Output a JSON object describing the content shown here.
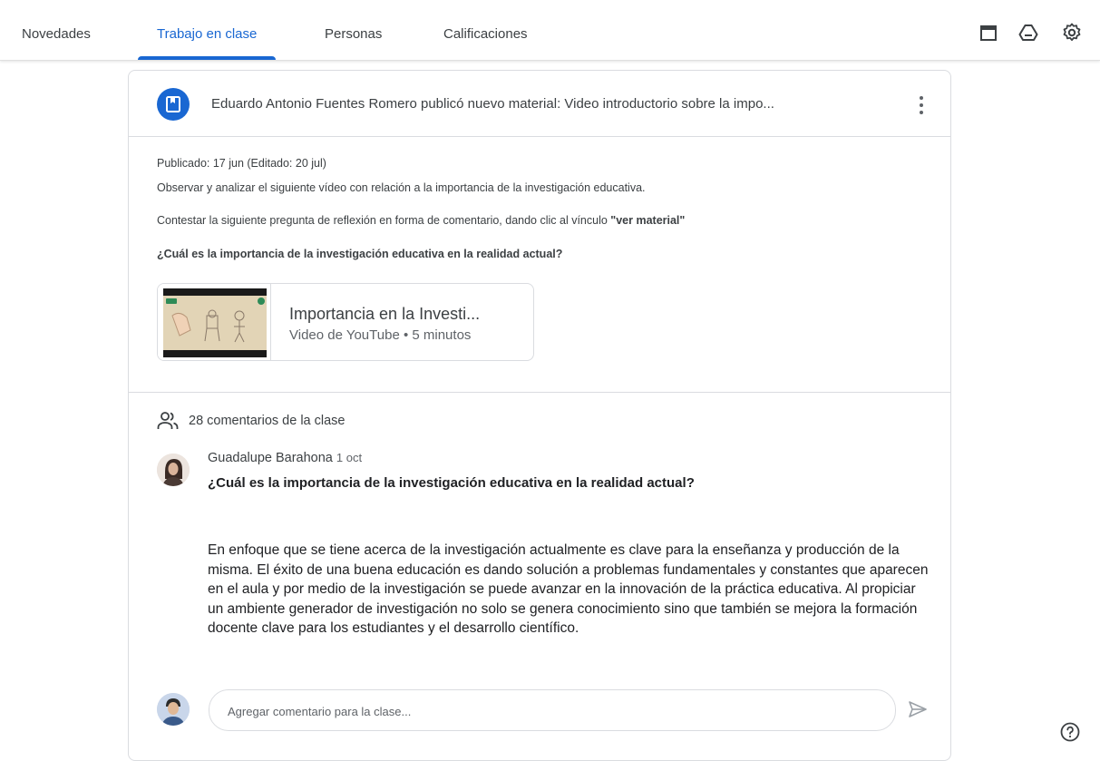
{
  "nav": {
    "tabs": [
      {
        "label": "Novedades",
        "active": false
      },
      {
        "label": "Trabajo en clase",
        "active": true
      },
      {
        "label": "Personas",
        "active": false
      },
      {
        "label": "Calificaciones",
        "active": false
      }
    ],
    "icons": [
      "calendar-icon",
      "google-drive-icon",
      "settings-icon"
    ]
  },
  "post": {
    "header": "Eduardo Antonio Fuentes Romero publicó nuevo material: Video introductorio sobre la impo...",
    "posted": "Publicado: 17 jun (Editado: 20 jul)",
    "description_1": "Observar y analizar el siguiente vídeo con relación a la importancia de la investigación educativa.",
    "description_2_prefix": "Contestar la siguiente pregunta de reflexión en forma de comentario, dando clic al vínculo ",
    "description_2_link": "\"ver material\"",
    "question": "¿Cuál es la importancia de la investigación educativa en la realidad actual?",
    "attachment": {
      "title": "Importancia en la Investi...",
      "subtitle": "Video de YouTube • 5 minutos"
    }
  },
  "comments": {
    "count_label": "28 comentarios de la clase",
    "items": [
      {
        "author": "Guadalupe Barahona",
        "date": "1 oct",
        "question": "¿Cuál es la importancia de la investigación educativa en la realidad actual?",
        "body": "En enfoque que se tiene acerca de la investigación actualmente es clave para la enseñanza y producción de la misma. El éxito de una buena educación es dando solución a problemas fundamentales y constantes que aparecen en el aula y por medio de la investigación se puede avanzar en la innovación de la práctica educativa. Al propiciar un ambiente generador de investigación no solo se genera conocimiento sino que también se mejora la formación docente clave para los estudiantes y el desarrollo científico."
      }
    ],
    "input_placeholder": "Agregar comentario para la clase..."
  },
  "colors": {
    "accent": "#1967d2",
    "text": "#3c4043",
    "border": "#dadce0"
  }
}
